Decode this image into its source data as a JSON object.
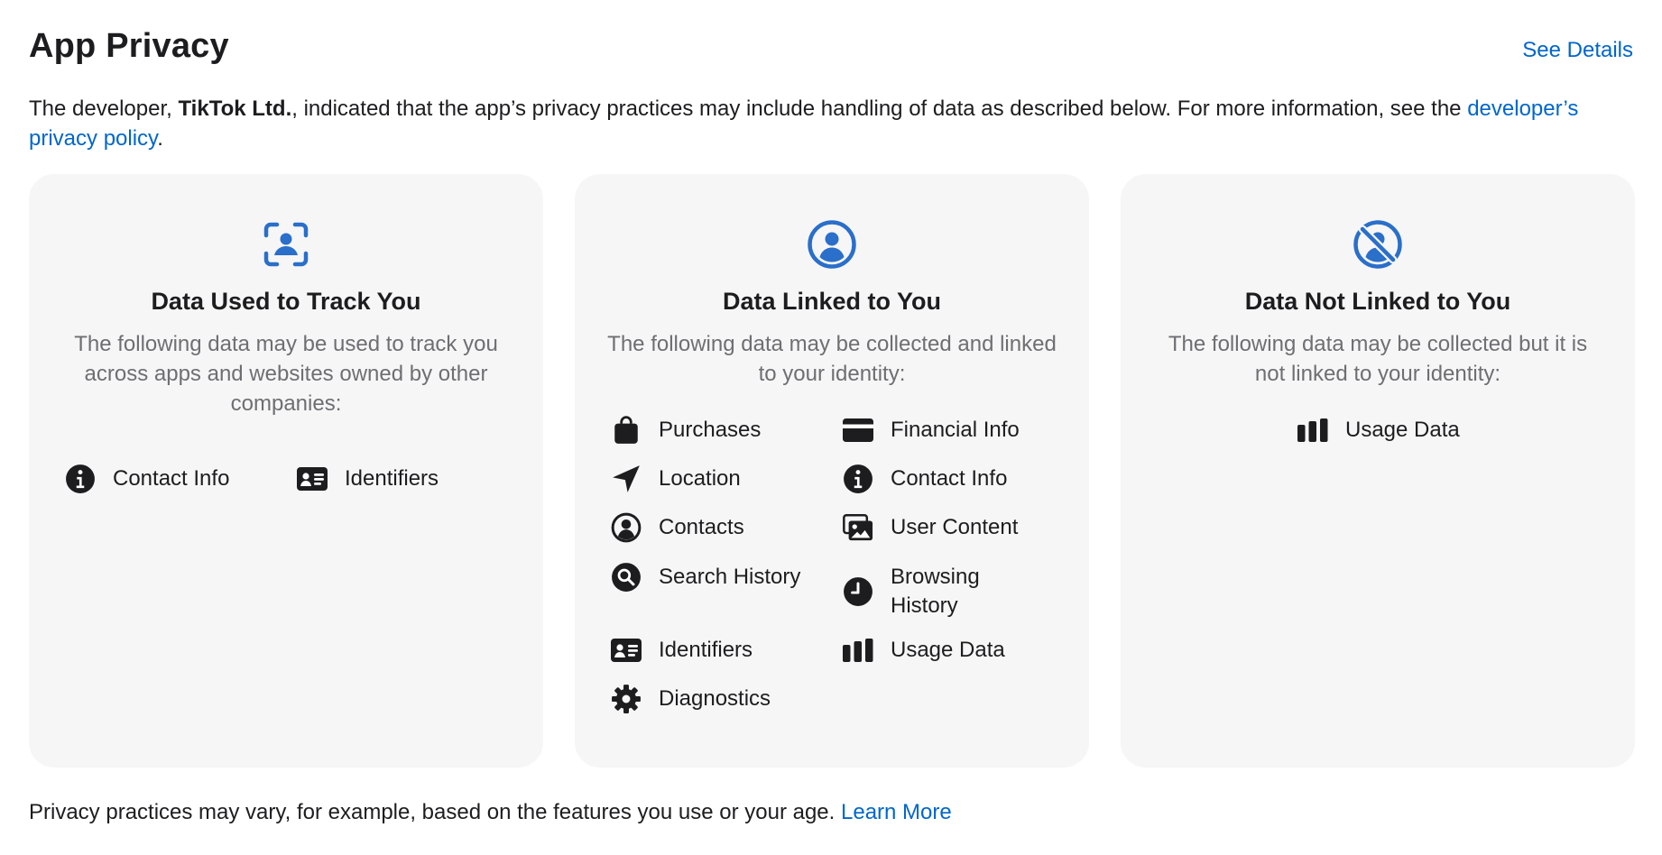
{
  "header": {
    "title": "App Privacy",
    "see_details": "See Details"
  },
  "intro": {
    "prefix": "The developer, ",
    "developer": "TikTok Ltd.",
    "middle": ", indicated that the app’s privacy practices may include handling of data as described below. For more information, see the ",
    "link": "developer’s privacy policy",
    "suffix": "."
  },
  "cards": [
    {
      "icon": "tracking-icon",
      "title": "Data Used to Track You",
      "description": "The following data may be used to track you across apps and websites owned by other companies:",
      "items": [
        {
          "label": "Contact Info",
          "icon": "info-circle-icon"
        },
        {
          "label": "Identifiers",
          "icon": "id-card-icon"
        }
      ]
    },
    {
      "icon": "person-circle-icon",
      "title": "Data Linked to You",
      "description": "The following data may be collected and linked to your identity:",
      "items": [
        {
          "label": "Purchases",
          "icon": "shopping-bag-icon"
        },
        {
          "label": "Financial Info",
          "icon": "credit-card-icon"
        },
        {
          "label": "Location",
          "icon": "location-arrow-icon"
        },
        {
          "label": "Contact Info",
          "icon": "info-circle-icon"
        },
        {
          "label": "Contacts",
          "icon": "contacts-icon"
        },
        {
          "label": "User Content",
          "icon": "photos-icon"
        },
        {
          "label": "Search History",
          "icon": "magnifier-icon"
        },
        {
          "label": "Browsing History",
          "icon": "clock-icon"
        },
        {
          "label": "Identifiers",
          "icon": "id-card-icon"
        },
        {
          "label": "Usage Data",
          "icon": "bar-chart-icon"
        },
        {
          "label": "Diagnostics",
          "icon": "gear-icon"
        }
      ]
    },
    {
      "icon": "person-slash-icon",
      "title": "Data Not Linked to You",
      "description": "The following data may be collected but it is not linked to your identity:",
      "items": [
        {
          "label": "Usage Data",
          "icon": "bar-chart-icon"
        }
      ]
    }
  ],
  "footer": {
    "text": "Privacy practices may vary, for example, based on the features you use or your age. ",
    "link": "Learn More"
  },
  "colors": {
    "accent": "#0066cc",
    "icon_blue": "#2a6fc9",
    "card_bg": "#f6f6f6",
    "muted_text": "#6e6e73"
  }
}
